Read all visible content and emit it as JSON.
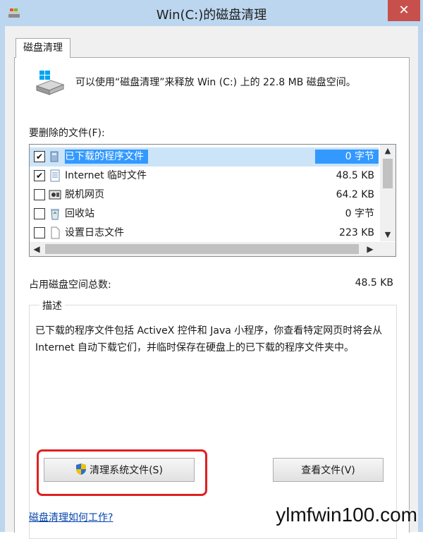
{
  "window": {
    "title": "Win(C:)的磁盘清理",
    "close_glyph": "✕"
  },
  "tab": {
    "label": "磁盘清理"
  },
  "summary": "可以使用“磁盘清理”来释放 Win (C:) 上的 22.8 MB 磁盘空间。",
  "files_label": "要删除的文件(F):",
  "files": [
    {
      "checked": true,
      "name": "已下载的程序文件",
      "size": "0 字节",
      "icon": "folder-icon"
    },
    {
      "checked": true,
      "name": "Internet 临时文件",
      "size": "48.5 KB",
      "icon": "document-icon"
    },
    {
      "checked": false,
      "name": "脱机网页",
      "size": "64.2 KB",
      "icon": "offline-page-icon"
    },
    {
      "checked": false,
      "name": "回收站",
      "size": "0 字节",
      "icon": "recycle-bin-icon"
    },
    {
      "checked": false,
      "name": "设置日志文件",
      "size": "223 KB",
      "icon": "blank-file-icon"
    }
  ],
  "check_glyph": "✔",
  "total_label": "占用磁盘空间总数:",
  "total_value": "48.5 KB",
  "description": {
    "title": "描述",
    "text": "已下载的程序文件包括 ActiveX 控件和 Java 小程序，你查看特定网页时将会从 Internet 自动下载它们，并临时保存在硬盘上的已下载的程序文件夹中。"
  },
  "buttons": {
    "clean_system": "清理系统文件(S)",
    "view_files": "查看文件(V)"
  },
  "help_link": "磁盘清理如何工作?",
  "watermark": "ylmfwin100.com",
  "colors": {
    "selection": "#3399ff",
    "highlight_ring": "#e02020",
    "close_button": "#c7504d",
    "frame": "#bcd6ef"
  }
}
